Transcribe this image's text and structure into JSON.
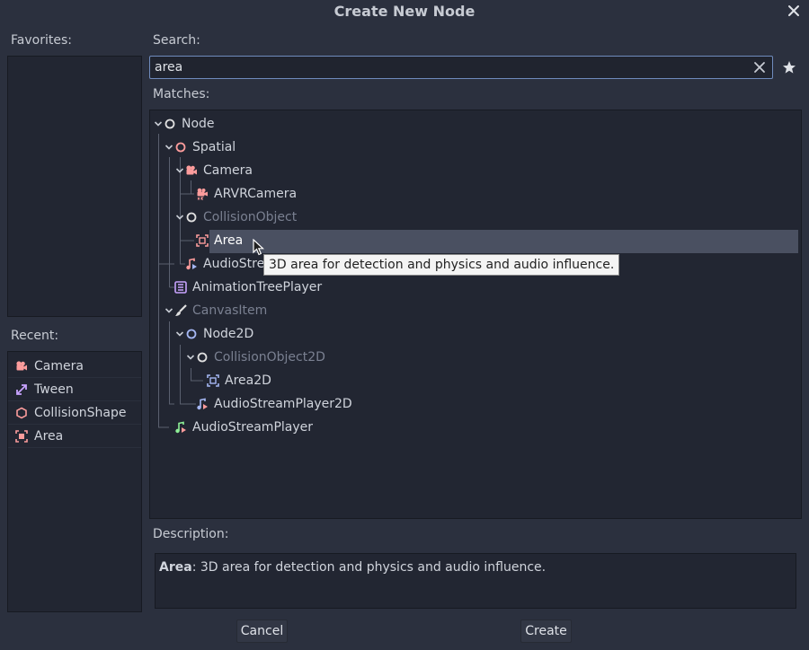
{
  "dialog": {
    "title": "Create New Node"
  },
  "favorites": {
    "label": "Favorites:"
  },
  "recent": {
    "label": "Recent:",
    "items": [
      {
        "label": "Camera",
        "icon": "camera-icon"
      },
      {
        "label": "Tween",
        "icon": "tween-icon"
      },
      {
        "label": "CollisionShape",
        "icon": "collision-shape-icon"
      },
      {
        "label": "Area",
        "icon": "area-icon"
      }
    ]
  },
  "search": {
    "label": "Search:",
    "value": "area"
  },
  "matches": {
    "label": "Matches:",
    "nodes": [
      {
        "label": "Node",
        "icon": "node-icon"
      },
      {
        "label": "Spatial",
        "icon": "spatial-icon"
      },
      {
        "label": "Camera",
        "icon": "camera-icon"
      },
      {
        "label": "ARVRCamera",
        "icon": "arvr-camera-icon"
      },
      {
        "label": "CollisionObject",
        "icon": "collision-object-icon",
        "disabled": true
      },
      {
        "label": "Area",
        "icon": "area-icon",
        "selected": true
      },
      {
        "label": "AudioStreamPlayer3D",
        "icon": "audio-stream-player-3d-icon"
      },
      {
        "label": "AnimationTreePlayer",
        "icon": "animation-tree-player-icon"
      },
      {
        "label": "CanvasItem",
        "icon": "canvas-item-icon",
        "disabled": true
      },
      {
        "label": "Node2D",
        "icon": "node2d-icon"
      },
      {
        "label": "CollisionObject2D",
        "icon": "collision-object-2d-icon",
        "disabled": true
      },
      {
        "label": "Area2D",
        "icon": "area2d-icon"
      },
      {
        "label": "AudioStreamPlayer2D",
        "icon": "audio-stream-player-2d-icon"
      },
      {
        "label": "AudioStreamPlayer",
        "icon": "audio-stream-player-icon"
      }
    ]
  },
  "tooltip": {
    "text": "3D area for detection and physics and audio influence."
  },
  "description": {
    "label": "Description:",
    "node_name": "Area",
    "text": ": 3D area for detection and physics and audio influence."
  },
  "buttons": {
    "cancel": "Cancel",
    "create": "Create"
  },
  "colors": {
    "spatial": "#fc9c9c",
    "node2d": "#a5b7f3",
    "base": "#e0e0e0",
    "accent": "#6f8bbd",
    "audio_orange": "#fc9c9c",
    "audio_green": "#8eef97",
    "purple": "#c7a2fd"
  }
}
